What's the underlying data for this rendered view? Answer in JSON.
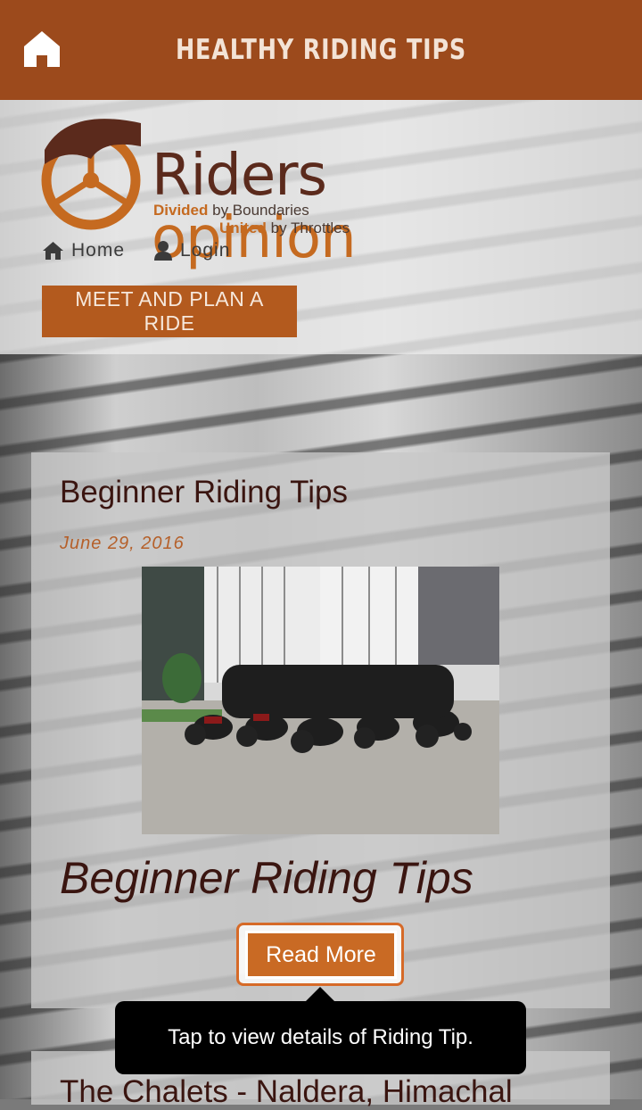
{
  "app_bar": {
    "title": "HEALTHY RIDING TIPS",
    "home_icon": "home-icon"
  },
  "logo": {
    "name_main": "Riders",
    "name_accent": "opinion",
    "tagline1_accent": "Divided",
    "tagline1_rest": " by Boundaries",
    "tagline2_accent": "United",
    "tagline2_rest": " by Throttles"
  },
  "nav": {
    "home_label": "Home",
    "login_label": "Login",
    "home_icon": "house-icon",
    "login_icon": "user-icon"
  },
  "plan_button": "MEET AND PLAN A RIDE",
  "posts": [
    {
      "title": "Beginner Riding Tips",
      "date": "June 29, 2016",
      "heading": "Beginner Riding Tips",
      "read_more": "Read More"
    },
    {
      "title": "The Chalets - Naldera, Himachal"
    }
  ],
  "tooltip": "Tap to view details of Riding Tip.",
  "colors": {
    "app_bar": "#9c4a1c",
    "accent": "#c96a24",
    "title_text": "#3a1510"
  }
}
